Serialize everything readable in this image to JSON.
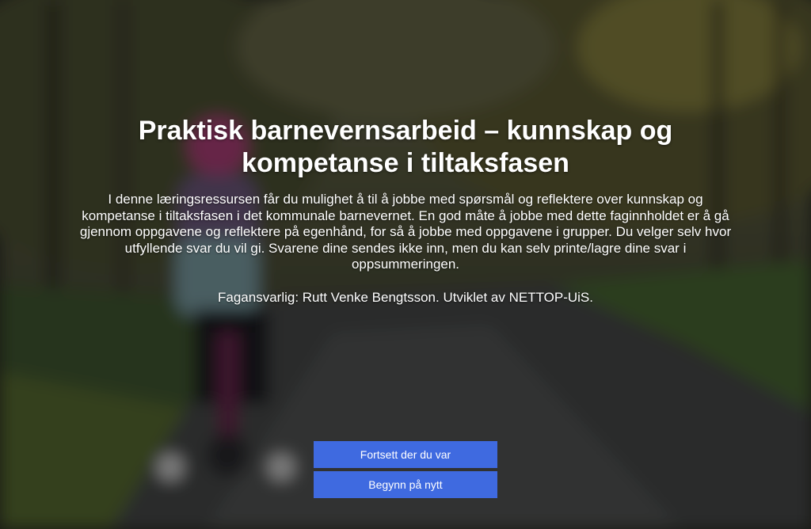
{
  "hero": {
    "title": "Praktisk barnevernsarbeid – kunnskap og kompetanse i tiltaksfasen",
    "intro": "I denne læringsressursen får du mulighet å til å jobbe med spørsmål og reflektere over kunnskap og kompetanse i tiltaksfasen i det kommunale barnevernet. En god måte å jobbe med dette faginnholdet er å gå gjennom oppgavene og reflektere på egenhånd, for så å jobbe med oppgavene i grupper. Du velger selv hvor utfyllende svar du vil gi. Svarene dine sendes ikke inn, men du kan selv printe/lagre dine svar i oppsummeringen.",
    "credits": "Fagansvarlig: Rutt Venke Bengtsson. Utviklet av NETTOP-UiS."
  },
  "actions": {
    "continue_label": "Fortsett der du var",
    "restart_label": "Begynn på nytt"
  },
  "colors": {
    "button_bg": "#3f6ae0",
    "text": "#ffffff"
  }
}
